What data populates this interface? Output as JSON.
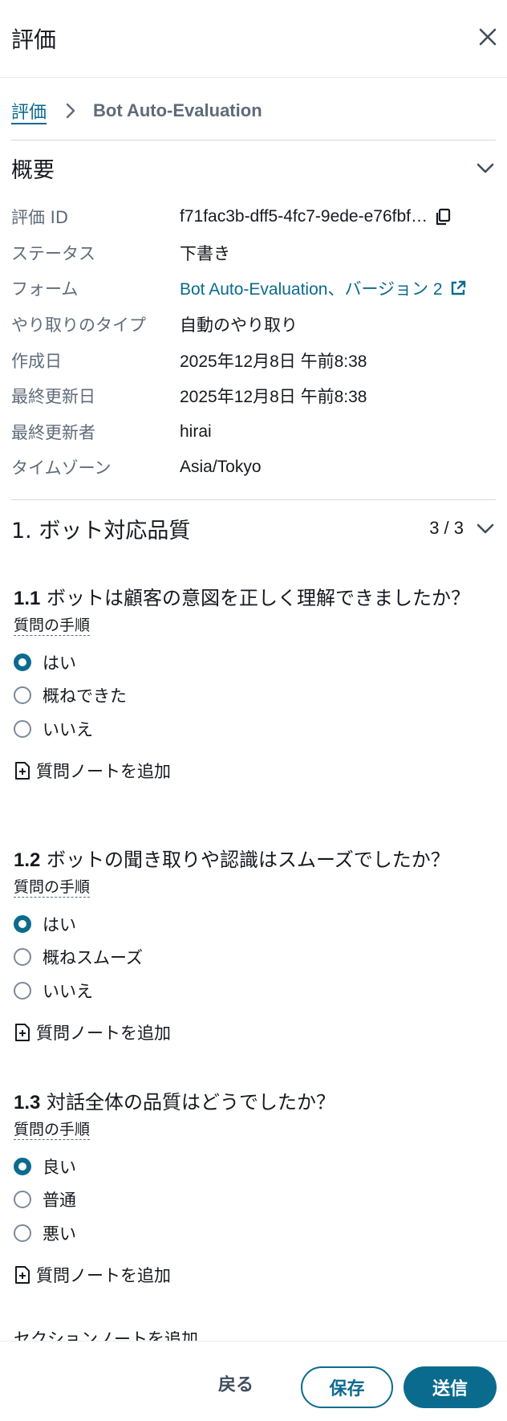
{
  "header": {
    "title": "評価",
    "close_icon": "close-icon"
  },
  "breadcrumb": {
    "link": "評価",
    "current": "Bot Auto-Evaluation"
  },
  "overview": {
    "title": "概要",
    "rows": [
      {
        "key": "評価 ID",
        "value": "f71fac3b-dff5-4fc7-9ede-e76fbf…",
        "icon": "copy-icon"
      },
      {
        "key": "ステータス",
        "value": "下書き"
      },
      {
        "key": "フォーム",
        "value": "Bot Auto-Evaluation、バージョン 2",
        "icon": "external-link-icon",
        "link": true
      },
      {
        "key": "やり取りのタイプ",
        "value": "自動のやり取り"
      },
      {
        "key": "作成日",
        "value": "2025年12月8日 午前8:38"
      },
      {
        "key": "最終更新日",
        "value": "2025年12月8日 午前8:38"
      },
      {
        "key": "最終更新者",
        "value": "hirai"
      },
      {
        "key": "タイムゾーン",
        "value": "Asia/Tokyo"
      }
    ]
  },
  "section1": {
    "title": "1. ボット対応品質",
    "count": "3 / 3",
    "questions": [
      {
        "number": "1.1",
        "text": " ボットは顧客の意図を正しく理解できましたか？",
        "instructions": "質問の手順",
        "options": [
          "はい",
          "概ねできた",
          "いいえ"
        ],
        "selected": 0,
        "add_note": "質問ノートを追加"
      },
      {
        "number": "1.2",
        "text": " ボットの聞き取りや認識はスムーズでしたか？",
        "instructions": "質問の手順",
        "options": [
          "はい",
          "概ねスムーズ",
          "いいえ"
        ],
        "selected": 0,
        "add_note": "質問ノートを追加"
      },
      {
        "number": "1.3",
        "text": " 対話全体の品質はどうでしたか？",
        "instructions": "質問の手順",
        "options": [
          "良い",
          "普通",
          "悪い"
        ],
        "selected": 0,
        "add_note": "質問ノートを追加"
      }
    ],
    "section_note": "セクションノートを追加"
  },
  "footer": {
    "back": "戻る",
    "save": "保存",
    "submit": "送信"
  },
  "colors": {
    "accent": "#0b6b8e",
    "text": "#16191f",
    "muted": "#5f6b7a",
    "divider": "#d5dbdb"
  }
}
